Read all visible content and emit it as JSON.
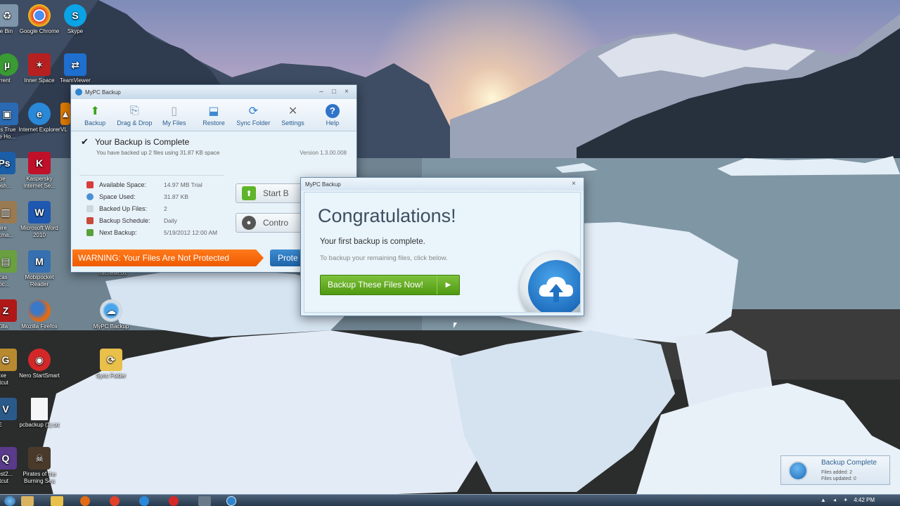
{
  "desktop": {
    "icons": [
      {
        "label": "cle Bin",
        "icon": "recycle-bin-icon",
        "color": "#7e95aa"
      },
      {
        "label": "Google Chrome",
        "icon": "chrome-icon",
        "color": "#e3402a"
      },
      {
        "label": "Skype",
        "icon": "skype-icon",
        "color": "#0aa3e6"
      },
      {
        "label": "orrent",
        "icon": "utorrent-icon",
        "color": "#3a9a33"
      },
      {
        "label": "Inner Space",
        "icon": "inner-space-icon",
        "color": "#b72020"
      },
      {
        "label": "TeamViewer",
        "icon": "teamviewer-icon",
        "color": "#1e6fd0"
      },
      {
        "label": "nis True ge Ho...",
        "icon": "acronis-icon",
        "color": "#2a6ab3"
      },
      {
        "label": "Internet Explorer",
        "icon": "internet-explorer-icon",
        "color": "#2a88d8"
      },
      {
        "label": "VL",
        "icon": "vlc-icon",
        "color": "#e07a00"
      },
      {
        "label": "dobe otosh...",
        "icon": "photoshop-icon",
        "color": "#1b5ea8"
      },
      {
        "label": "Kaspersky Internet Se...",
        "icon": "kaspersky-icon",
        "color": "#c0102a"
      },
      {
        "label": "quire Skma...",
        "icon": "app-icon",
        "color": "#9a7a50"
      },
      {
        "label": "Microsoft Word 2010",
        "icon": "word-icon",
        "color": "#1f58b0"
      },
      {
        "label": "nicas nloc...",
        "icon": "app-icon",
        "color": "#6aa040"
      },
      {
        "label": "Mobipocket Reader",
        "icon": "mobipocket-icon",
        "color": "#3670b0"
      },
      {
        "label": "michelle.txt",
        "icon": "text-file-icon",
        "color": "#dfe6ee"
      },
      {
        "label": "eZilla",
        "icon": "filezilla-icon",
        "color": "#b01818"
      },
      {
        "label": "Mozilla Firefox",
        "icon": "firefox-icon",
        "color": "#e26a14"
      },
      {
        "label": "MyPC Backup",
        "icon": "mypc-backup-icon",
        "color": "#2f84cf"
      },
      {
        "label": "l.exe ortcut",
        "icon": "app-icon",
        "color": "#b88a30"
      },
      {
        "label": "Nero StartSmart",
        "icon": "nero-icon",
        "color": "#d42828"
      },
      {
        "label": "Sync Folder",
        "icon": "sync-folder-icon",
        "color": "#e8c04a"
      },
      {
        "label": "VE",
        "icon": "app-icon",
        "color": "#2a5a8a"
      },
      {
        "label": "pcbackup (1).txt",
        "icon": "text-file-icon",
        "color": "#f4f6f8"
      },
      {
        "label": "uest2... ortcut",
        "icon": "app-icon",
        "color": "#5a3a8a"
      },
      {
        "label": "Pirates of the Burning Sea",
        "icon": "pirates-icon",
        "color": "#4a3a2a"
      }
    ]
  },
  "main_window": {
    "title": "MyPC Backup",
    "toolbar": [
      {
        "label": "Backup",
        "icon": "backup-arrow-icon",
        "color": "#3ea31c"
      },
      {
        "label": "Drag & Drop",
        "icon": "drag-drop-icon",
        "color": "#6a8fb3"
      },
      {
        "label": "My Files",
        "icon": "files-icon",
        "color": "#9aa6b2"
      },
      {
        "label": "Restore",
        "icon": "restore-icon",
        "color": "#3f8ad0"
      },
      {
        "label": "Sync Folder",
        "icon": "sync-icon",
        "color": "#2c7fd1"
      },
      {
        "label": "Settings",
        "icon": "settings-tools-icon",
        "color": "#6a6a6a"
      },
      {
        "label": "Help",
        "icon": "help-icon",
        "color": "#2f74c8"
      }
    ],
    "status_headline": "Your Backup is Complete",
    "status_sub": "You have backed up 2 files using 31.87 KB space",
    "version": "Version 1.3.00.008",
    "stats": [
      {
        "label": "Available Space:",
        "value": "14.97 MB Trial",
        "color": "#d83c3c"
      },
      {
        "label": "Space Used:",
        "value": "31.87 KB",
        "color": "#4a8fd6"
      },
      {
        "label": "Backed Up Files:",
        "value": "2",
        "color": "#cfd7de"
      },
      {
        "label": "Backup Schedule:",
        "value": "Daily",
        "color": "#c94a3a"
      },
      {
        "label": "Next Backup:",
        "value": "5/19/2012 12:00 AM",
        "color": "#5aa03a"
      }
    ],
    "start_button": "Start B",
    "control_button": "Contro",
    "warning": "WARNING: Your Files Are Not Protected",
    "protect_button": "Prote"
  },
  "dialog": {
    "title": "MyPC Backup",
    "heading": "Congratulations!",
    "line1": "Your first backup is complete.",
    "line2": "To backup your remaining files, click below.",
    "cta": "Backup These Files Now!"
  },
  "toast": {
    "title": "Backup Complete",
    "line1": "Files added: 2",
    "line2": "Files updated: 0"
  },
  "taskbar": {
    "clock": "4:42 PM"
  }
}
